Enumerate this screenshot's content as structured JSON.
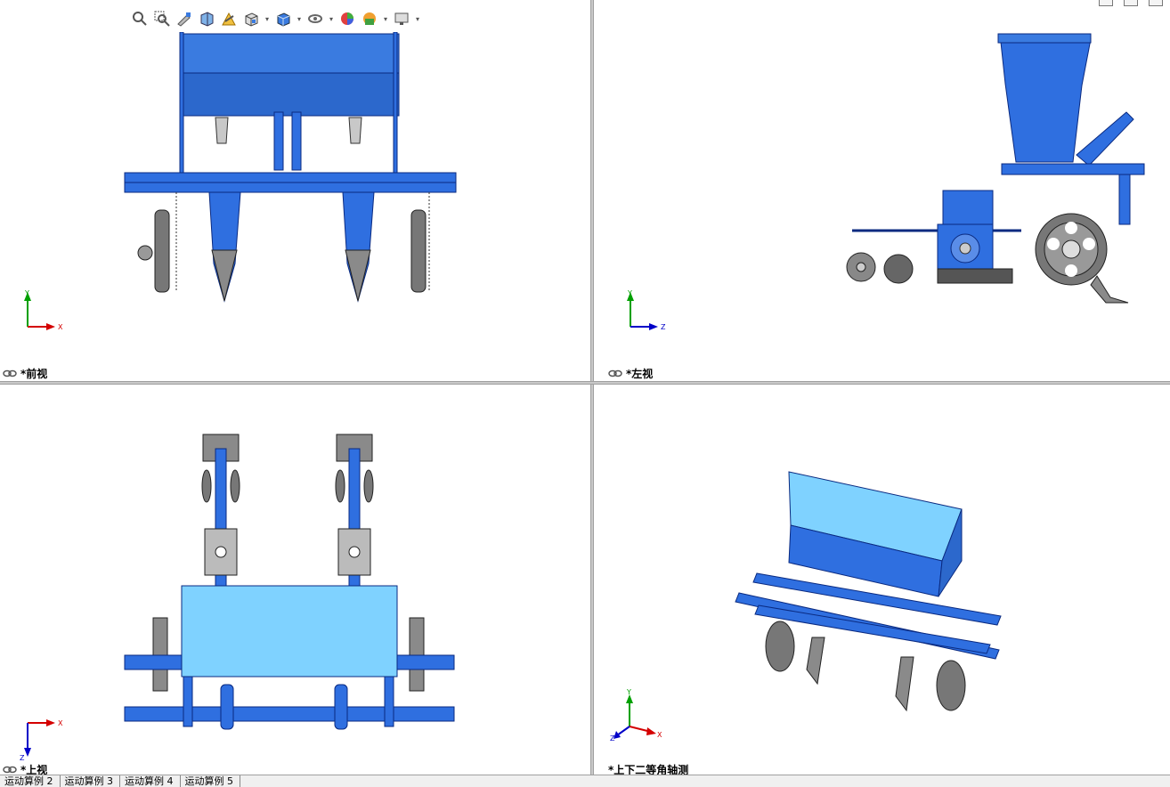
{
  "views": {
    "front": {
      "label": "*前视"
    },
    "left": {
      "label": "*左视"
    },
    "top": {
      "label": "*上视"
    },
    "iso": {
      "label": "*上下二等角轴测"
    }
  },
  "axes": {
    "front": {
      "h": "X",
      "v": "Y"
    },
    "left": {
      "h": "Z",
      "v": "Y"
    },
    "top": {
      "h": "X",
      "v": "Z"
    },
    "iso": {
      "x": "X",
      "y": "Y",
      "z": "Z"
    }
  },
  "toolbar": {
    "icons": [
      "zoom-to-fit-icon",
      "zoom-to-area-icon",
      "previous-view-icon",
      "section-view-icon",
      "dynamic-annotation-icon",
      "view-orientation-icon",
      "display-style-icon",
      "hide-show-items-icon",
      "edit-appearance-icon",
      "apply-scene-icon",
      "view-settings-icon"
    ]
  },
  "tabs": [
    "运动算例 2",
    "运动算例 3",
    "运动算例 4",
    "运动算例 5"
  ],
  "colors": {
    "model_blue": "#2f6fe0",
    "hopper_light": "#7fd2ff",
    "steel": "#8a8a8a",
    "axis_x": "#d40000",
    "axis_y": "#00a000",
    "axis_z": "#0000c8"
  }
}
